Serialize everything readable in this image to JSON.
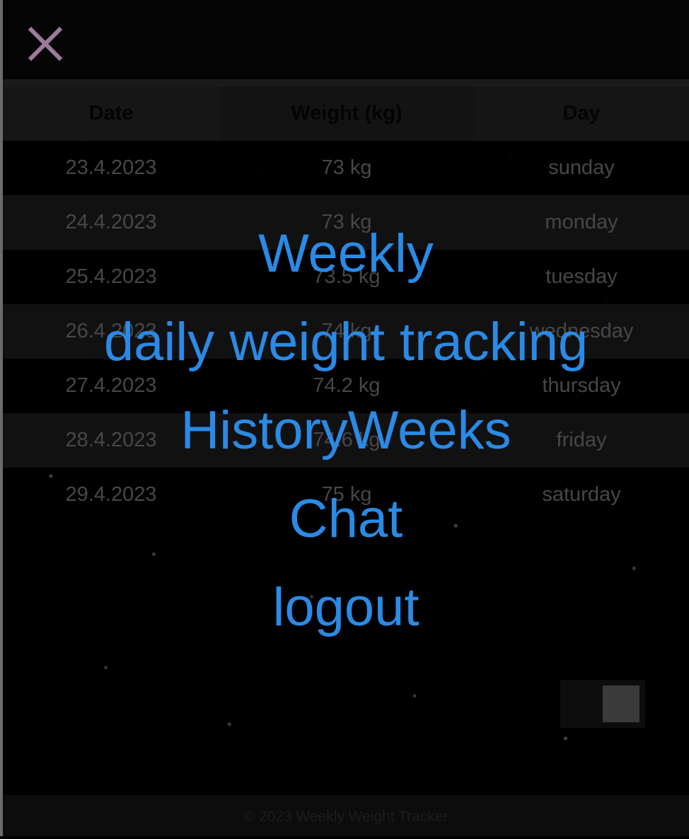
{
  "header": {
    "close_icon": "close-icon",
    "close_color": "#9b7a9b"
  },
  "table": {
    "columns": [
      "Date",
      "Weight (kg)",
      "Day"
    ],
    "rows": [
      {
        "date": "23.4.2023",
        "weight": "73 kg",
        "day": "sunday"
      },
      {
        "date": "24.4.2023",
        "weight": "73 kg",
        "day": "monday"
      },
      {
        "date": "25.4.2023",
        "weight": "73.5 kg",
        "day": "tuesday"
      },
      {
        "date": "26.4.2023",
        "weight": "74 kg",
        "day": "wednesday"
      },
      {
        "date": "27.4.2023",
        "weight": "74.2 kg",
        "day": "thursday"
      },
      {
        "date": "28.4.2023",
        "weight": "74.6 kg",
        "day": "friday"
      },
      {
        "date": "29.4.2023",
        "weight": "75 kg",
        "day": "saturday"
      }
    ]
  },
  "nav": {
    "items": [
      {
        "label": "Weekly"
      },
      {
        "label": "daily weight tracking"
      },
      {
        "label": "HistoryWeeks"
      },
      {
        "label": "Chat"
      },
      {
        "label": "logout"
      }
    ],
    "link_color": "#2a8ae6"
  },
  "toggle": {
    "state": "on"
  },
  "footer": {
    "text": "© 2023 Weekly Weight Tracker"
  }
}
